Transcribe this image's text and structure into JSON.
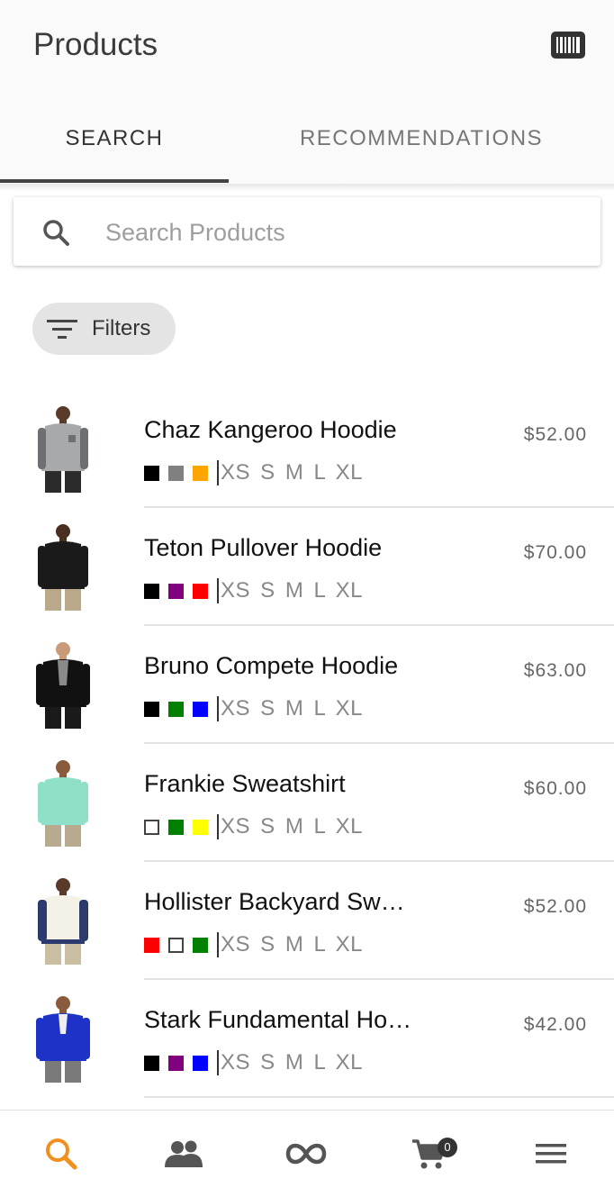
{
  "header": {
    "title": "Products",
    "barcode_icon": "barcode-scan-icon"
  },
  "tabs": [
    {
      "label": "SEARCH",
      "active": true
    },
    {
      "label": "RECOMMENDATIONS",
      "active": false
    }
  ],
  "search": {
    "placeholder": "Search Products",
    "value": ""
  },
  "filters": {
    "label": "Filters"
  },
  "products": [
    {
      "name": "Chaz Kangeroo Hoodie",
      "price": "$52.00",
      "colors": [
        "#000000",
        "#808080",
        "#ffa500"
      ],
      "sizes": "XS S M L XL"
    },
    {
      "name": "Teton Pullover Hoodie",
      "price": "$70.00",
      "colors": [
        "#000000",
        "#800080",
        "#ff0000"
      ],
      "sizes": "XS S M L XL"
    },
    {
      "name": "Bruno Compete Hoodie",
      "price": "$63.00",
      "colors": [
        "#000000",
        "#008000",
        "#0000ff"
      ],
      "sizes": "XS S M L XL"
    },
    {
      "name": "Frankie Sweatshirt",
      "price": "$60.00",
      "colors": [
        "#ffffff",
        "#008000",
        "#ffff00"
      ],
      "sizes": "XS S M L XL"
    },
    {
      "name": "Hollister Backyard Sw…",
      "price": "$52.00",
      "colors": [
        "#ff0000",
        "#ffffff",
        "#008000"
      ],
      "sizes": "XS S M L XL"
    },
    {
      "name": "Stark Fundamental Ho…",
      "price": "$42.00",
      "colors": [
        "#000000",
        "#800080",
        "#0000ff"
      ],
      "sizes": "XS S M L XL"
    }
  ],
  "bottom_nav": {
    "items": [
      {
        "icon": "search-icon",
        "active": true
      },
      {
        "icon": "people-icon",
        "active": false
      },
      {
        "icon": "infinity-icon",
        "active": false
      },
      {
        "icon": "cart-icon",
        "active": false
      },
      {
        "icon": "menu-icon",
        "active": false
      }
    ],
    "cart_count": "0"
  },
  "colors": {
    "accent": "#f0901e",
    "icon": "#555555",
    "tab_indicator": "#424242"
  }
}
